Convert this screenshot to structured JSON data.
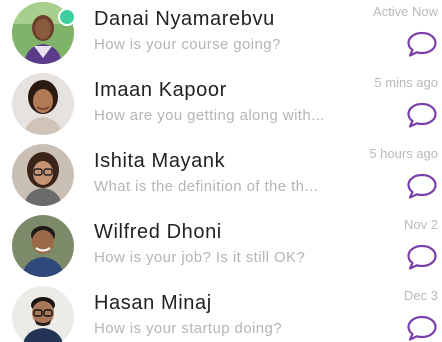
{
  "theme": {
    "accent": "#7b3fa8",
    "online_dot": "#3fcf9f"
  },
  "conversations": [
    {
      "name": "Danai Nyamarebvu",
      "preview": "How is your course going?",
      "time": "Active Now",
      "online": true,
      "icon": "chat-bubble-icon"
    },
    {
      "name": "Imaan Kapoor",
      "preview": "How are you getting along with...",
      "time": "5 mins ago",
      "online": false,
      "icon": "chat-bubble-icon"
    },
    {
      "name": "Ishita Mayank",
      "preview": "What is the definition of the th...",
      "time": "5 hours ago",
      "online": false,
      "icon": "chat-bubble-icon"
    },
    {
      "name": "Wilfred Dhoni",
      "preview": "How is your job? Is it still OK?",
      "time": "Nov 2",
      "online": false,
      "icon": "chat-bubble-icon"
    },
    {
      "name": "Hasan Minaj",
      "preview": "How is your startup doing?",
      "time": "Dec 3",
      "online": false,
      "icon": "chat-bubble-icon"
    }
  ]
}
